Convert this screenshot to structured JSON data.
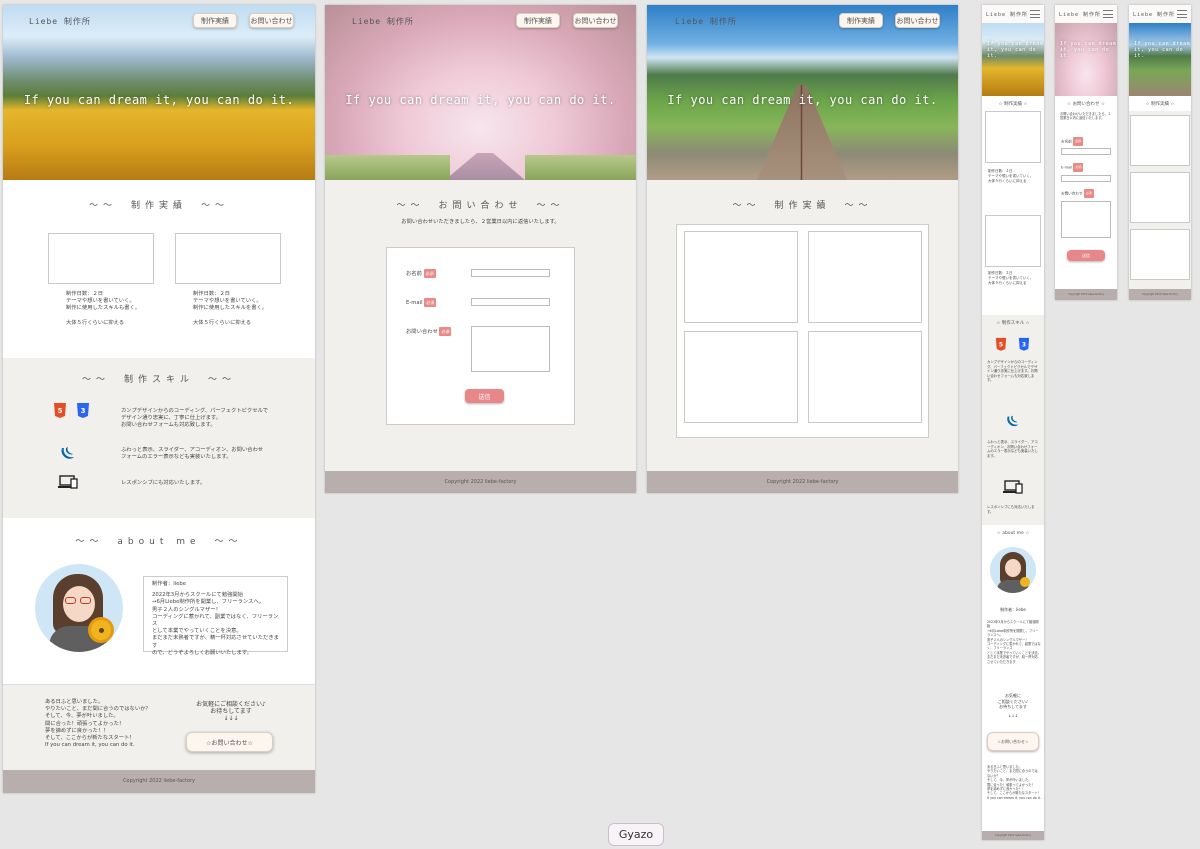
{
  "brand": "Liebe 制作所",
  "nav": {
    "works": "制作実績",
    "contact": "お問い合わせ"
  },
  "hero_text": "If you can dream it, you can do it.",
  "hero_text_mobile": "If you can dream it, you can do it.",
  "works": {
    "title": "〜〜　制作実績　〜〜",
    "items": [
      {
        "line1": "制作日数：２日",
        "line2": "テーマや想いを書いていく。",
        "line3": "制作に使用したスキルも書く。",
        "line4": "大体５行くらいに抑える"
      },
      {
        "line1": "制作日数：２日",
        "line2": "テーマや想いを書いていく。",
        "line3": "制作に使用したスキルを書く。",
        "line4": "大体５行くらいに抑える"
      }
    ]
  },
  "skills": {
    "title": "〜〜　制作スキル　〜〜",
    "html_label": "HTML",
    "css_label": "CSS",
    "jquery_label": "jQuery",
    "rows": [
      {
        "line1": "カンプデザインからのコーディング、パーフェクトピクセルで",
        "line2": "デザイン通り忠実に、丁寧に仕上げます。",
        "line3": "お問い合わせフォームも対応致します。"
      },
      {
        "line1": "ふわっと表示、スライダー、アコーディオン、お問い合わせ",
        "line2": "フォームのエラー表示なども実装いたします。",
        "line3": ""
      },
      {
        "line1": "レスポンシブにも対応いたします。",
        "line2": "",
        "line3": ""
      }
    ]
  },
  "about": {
    "title": "〜〜　about me　〜〜",
    "author": "制作者：liebe",
    "lines": [
      "2022年3月からスクールにて勉強開始",
      "→6月Liebe制作所を開業し、フリーランスへ。",
      "男子２人のシングルマザー！",
      "コーディングに惹かれて、副業ではなく、フリーランス",
      "として本業でやっていくことを決意。",
      "まだまだ未熟者ですが、精一杯対応させていただきます",
      "ので、どうぞよろしくお願いいたします。"
    ]
  },
  "closing": {
    "lines": [
      "ある日ふと思いました。",
      "やりたいこと、まだ間に合うのではないか？",
      "そして、今、夢が叶いました。",
      "間に合った！頑張ってよかった！",
      "夢を諦めずに良かった！！",
      "そして、ここからが新たなスタート！",
      "If you can dream it, you can do it."
    ],
    "cta_line1": "お気軽にご相談ください♪",
    "cta_line2": "お待ちしてます",
    "arrows": "↓↓↓",
    "cta_button": "☆お問い合わせ☆"
  },
  "contact": {
    "title": "〜〜　お問い合わせ　〜〜",
    "note": "お問い合わせいただきましたら、２営業日以内に返信いたします。",
    "name_label": "お名前",
    "email_label": "E-mail",
    "message_label": "お問い合わせ",
    "required": "必須",
    "submit": "送信"
  },
  "mobile": {
    "works_title": "☆ 制作実績 ☆",
    "skills_title": "☆ 制作スキル ☆",
    "about_title": "☆ about me ☆",
    "contact_title": "☆ お問い合わせ ☆",
    "skill_text": "カンプデザインからのコーディング、パーフェクトピクセルでデザイン通り忠実に仕上げます。お問い合わせフォームも対応致します。",
    "jquery_text": "ふわっと表示、スライダー、アコーディオン、お問い合わせフォームのエラー表示なども実装いたします。",
    "responsive_text": "レスポンシブにも対応いたします。",
    "cta_line1": "お気軽に",
    "cta_line2": "ご相談ください♪",
    "cta_line3": "お待ちしてます"
  },
  "footer": "Copyright 2022 liebe-factory",
  "gyazo": "Gyazo",
  "colors": {
    "accent": "#e8878a",
    "footer": "#b8aeae",
    "section_bg": "#f2f0ed"
  }
}
